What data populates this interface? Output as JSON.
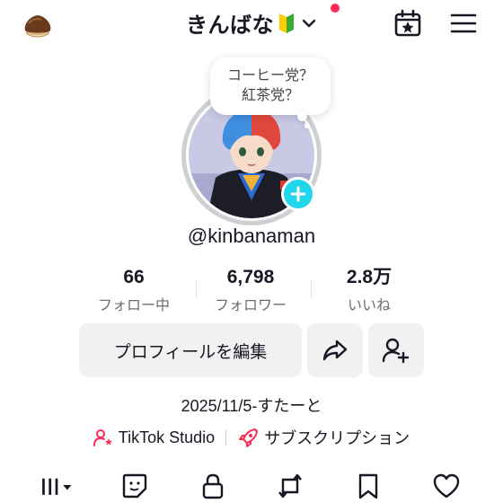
{
  "header": {
    "title": "きんばな",
    "account_icon": "chestnut-icon",
    "beginner_badge": "beginner-mark-icon",
    "notification_dot_color": "#fe2c55"
  },
  "bubble": {
    "line1": "コーヒー党？",
    "line2": "紅茶党？"
  },
  "profile": {
    "username": "@kinbanaman"
  },
  "stats": [
    {
      "value": "66",
      "label": "フォロー中"
    },
    {
      "value": "6,798",
      "label": "フォロワー"
    },
    {
      "value": "2.8万",
      "label": "いいね"
    }
  ],
  "actions": {
    "edit_label": "プロフィールを編集"
  },
  "bio": "2025/11/5-すたーと",
  "links": {
    "studio": "TikTok Studio",
    "subscription": "サブスクリプション"
  },
  "tabs": [
    "grid-icon",
    "sticker-icon",
    "lock-icon",
    "repost-icon",
    "bookmark-icon",
    "heart-icon"
  ],
  "colors": {
    "accent_cyan": "#20d5ec",
    "accent_pink": "#fe2c55"
  }
}
